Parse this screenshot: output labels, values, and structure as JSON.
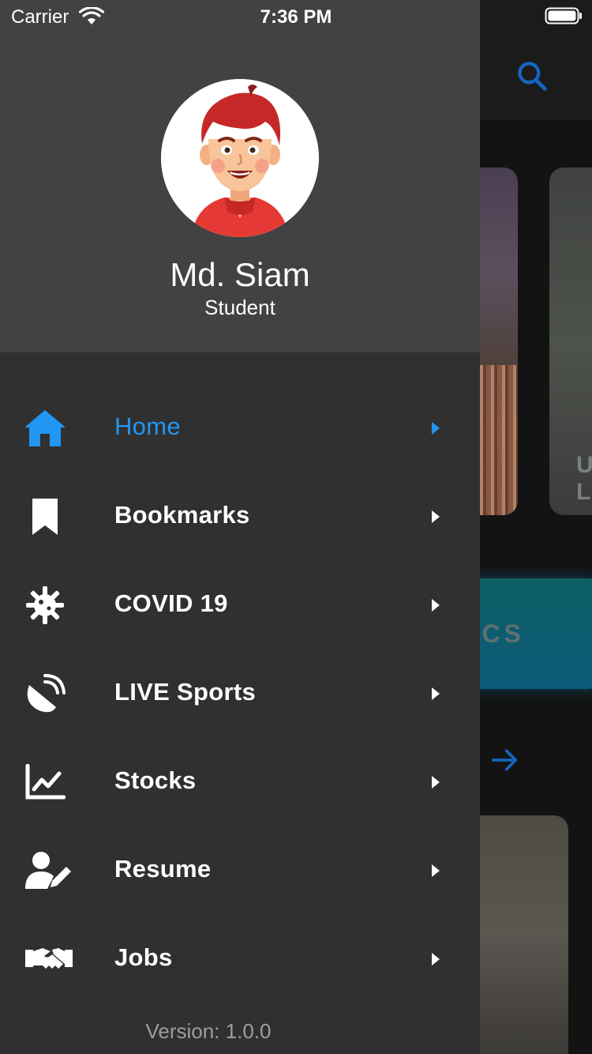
{
  "status_bar": {
    "carrier": "Carrier",
    "time": "7:36 PM"
  },
  "background": {
    "banner_text": "TICS",
    "card_text": "U\nL"
  },
  "profile": {
    "name": "Md. Siam",
    "role": "Student"
  },
  "menu": [
    {
      "label": "Home",
      "icon": "home-icon",
      "active": true
    },
    {
      "label": "Bookmarks",
      "icon": "bookmark-icon",
      "active": false
    },
    {
      "label": "COVID 19",
      "icon": "virus-icon",
      "active": false
    },
    {
      "label": "LIVE Sports",
      "icon": "satellite-dish-icon",
      "active": false
    },
    {
      "label": "Stocks",
      "icon": "chart-line-icon",
      "active": false
    },
    {
      "label": "Resume",
      "icon": "user-edit-icon",
      "active": false
    },
    {
      "label": "Jobs",
      "icon": "handshake-icon",
      "active": false
    }
  ],
  "footer": {
    "version": "Version: 1.0.0"
  },
  "colors": {
    "accent": "#2196f3",
    "drawer_bg": "#303030",
    "header_bg": "#424242"
  }
}
